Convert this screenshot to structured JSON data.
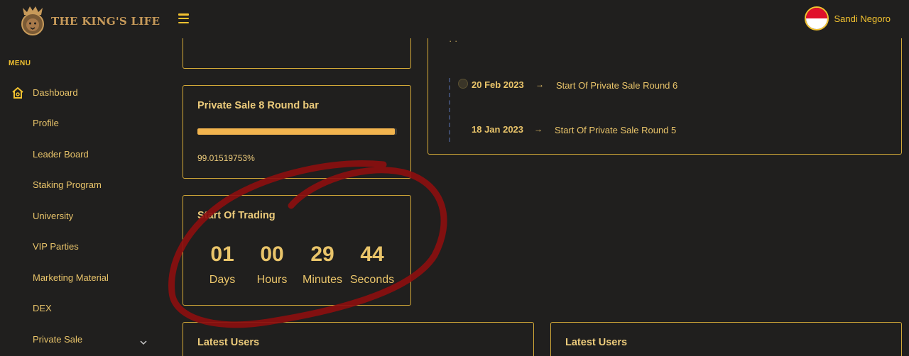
{
  "header": {
    "brand": "THE KING'S LIFE",
    "user_name": "Sandi Negoro"
  },
  "sidebar": {
    "menu_title": "MENU",
    "items": [
      {
        "label": "Dashboard",
        "icon": "home-icon"
      },
      {
        "label": "Profile"
      },
      {
        "label": "Leader Board"
      },
      {
        "label": "Staking Program"
      },
      {
        "label": "University"
      },
      {
        "label": "VIP Parties"
      },
      {
        "label": "Marketing Material"
      },
      {
        "label": "DEX"
      },
      {
        "label": "Private Sale",
        "icon": "chevron-down-icon"
      }
    ]
  },
  "private_sale_card": {
    "title": "Private Sale 8 Round bar",
    "progress_percent": 99.01519753,
    "progress_text": "99.01519753%"
  },
  "countdown": {
    "title": "Start Of Trading",
    "units": [
      {
        "value": "01",
        "label": "Days"
      },
      {
        "value": "00",
        "label": "Hours"
      },
      {
        "value": "29",
        "label": "Minutes"
      },
      {
        "value": "44",
        "label": "Seconds"
      }
    ]
  },
  "timeline": {
    "items": [
      {
        "date": "20 Feb 2023",
        "arrow": "→",
        "text": "Start Of Private Sale Round 6"
      },
      {
        "date": "18 Jan 2023",
        "arrow": "→",
        "text": "Start Of Private Sale Round 5"
      }
    ]
  },
  "latest_users": {
    "left_title": "Latest Users",
    "right_title": "Latest Users"
  },
  "colors": {
    "background": "#201f1e",
    "accent": "#f2c230",
    "card_border": "#d3a938",
    "progress": "#f2b44e",
    "annotation": "#8b0f0f"
  }
}
